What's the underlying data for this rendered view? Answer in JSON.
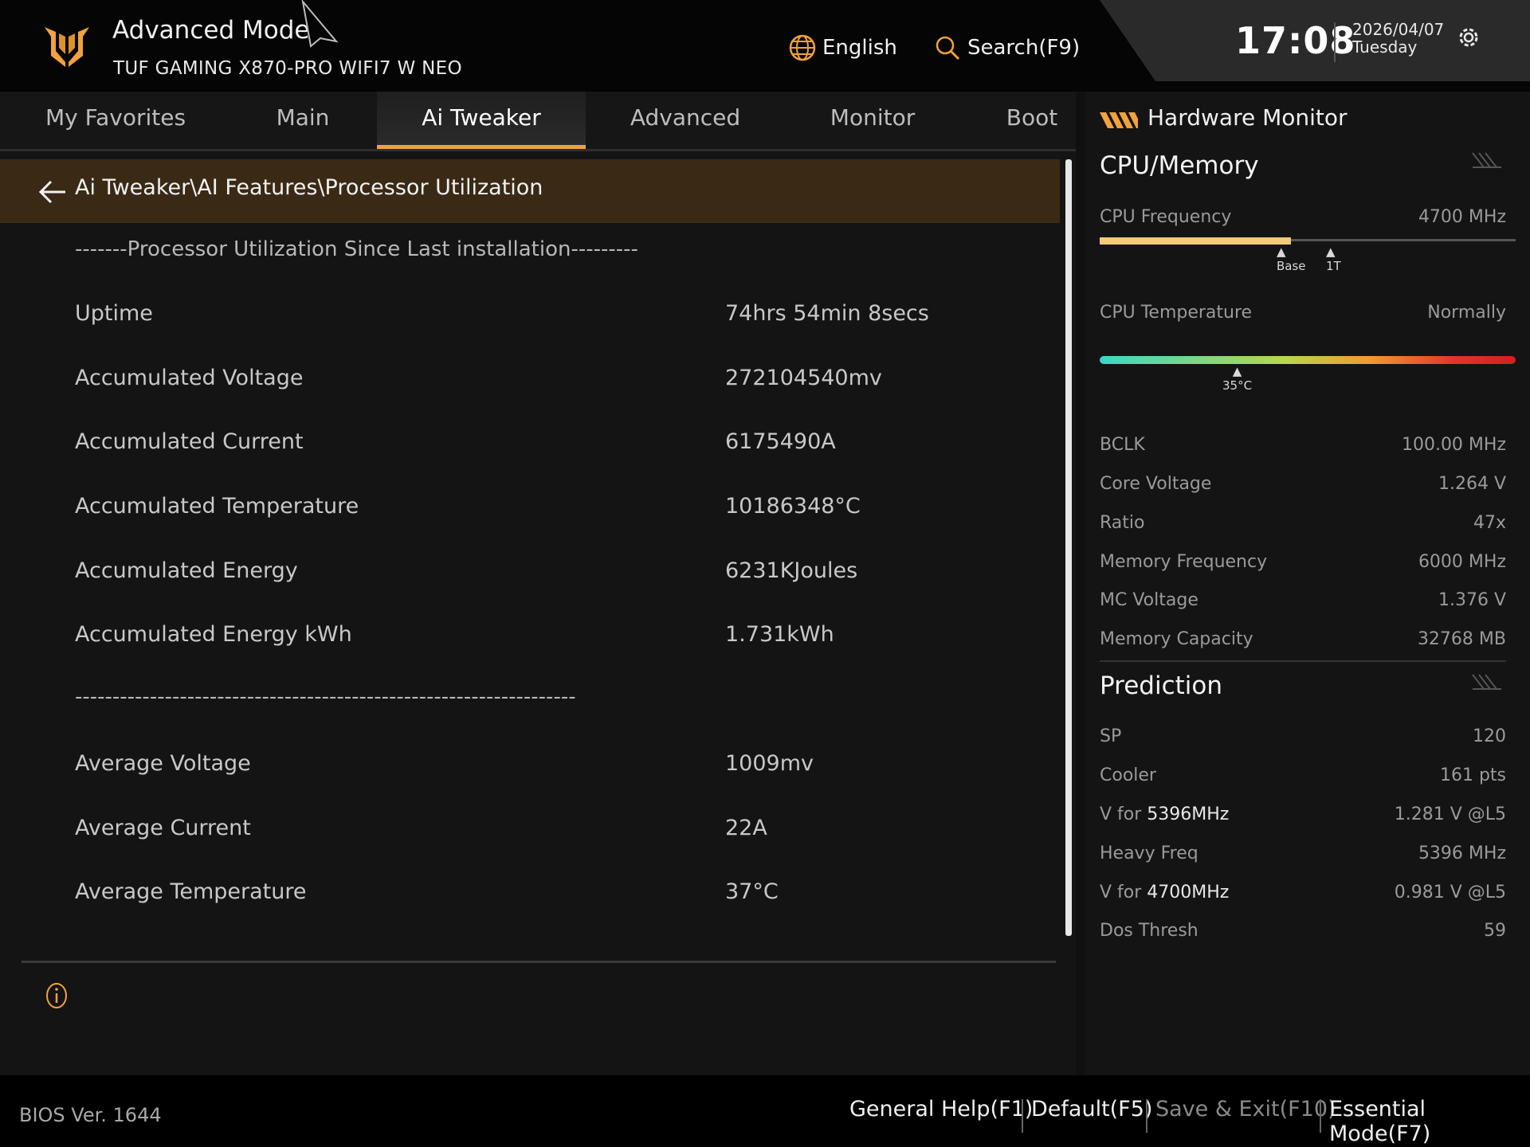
{
  "header": {
    "mode_title": "Advanced Mode",
    "board_name": "TUF GAMING X870-PRO WIFI7 W NEO",
    "language_label": "English",
    "search_label": "Search(F9)",
    "time": "17:08",
    "date": "2026/04/07",
    "weekday": "Tuesday"
  },
  "tabs": [
    {
      "label": "My Favorites"
    },
    {
      "label": "Main"
    },
    {
      "label": "Ai Tweaker"
    },
    {
      "label": "Advanced"
    },
    {
      "label": "Monitor"
    },
    {
      "label": "Boot"
    }
  ],
  "main": {
    "breadcrumb": "Ai Tweaker\\AI Features\\Processor Utilization",
    "section_header": "-------Processor Utilization Since Last installation---------",
    "separator": "-------------------------------------------------------------------",
    "rows": [
      {
        "label": "Uptime",
        "value": "74hrs 54min 8secs"
      },
      {
        "label": "Accumulated Voltage",
        "value": "272104540mv"
      },
      {
        "label": "Accumulated Current",
        "value": "6175490A"
      },
      {
        "label": "Accumulated Temperature",
        "value": "10186348°C"
      },
      {
        "label": "Accumulated Energy",
        "value": "6231KJoules"
      },
      {
        "label": "Accumulated Energy kWh",
        "value": "1.731kWh"
      }
    ],
    "avg_rows": [
      {
        "label": "Average Voltage",
        "value": "1009mv"
      },
      {
        "label": "Average Current",
        "value": "22A"
      },
      {
        "label": "Average Temperature",
        "value": "37°C"
      }
    ]
  },
  "hw_monitor": {
    "title": "Hardware Monitor",
    "cpu_section": "CPU/Memory",
    "cpu_freq_label": "CPU Frequency",
    "cpu_freq_value": "4700 MHz",
    "cpu_freq_fill_fraction": 0.46,
    "freq_marker_base": "Base",
    "freq_marker_1t": "1T",
    "cpu_temp_label": "CPU Temperature",
    "cpu_temp_value": "Normally",
    "cpu_temp_marker": "35°C",
    "stats": [
      {
        "label": "BCLK",
        "value": "100.00 MHz"
      },
      {
        "label": "Core Voltage",
        "value": "1.264 V"
      },
      {
        "label": "Ratio",
        "value": "47x"
      },
      {
        "label": "Memory Frequency",
        "value": "6000 MHz"
      },
      {
        "label": "MC Voltage",
        "value": "1.376 V"
      },
      {
        "label": "Memory Capacity",
        "value": "32768 MB"
      }
    ],
    "prediction_section": "Prediction",
    "prediction": [
      {
        "label": "SP",
        "value": "120"
      },
      {
        "label": "Cooler",
        "value": "161 pts"
      },
      {
        "label_prefix": "V for ",
        "label_bold": "5396MHz",
        "value": "1.281 V @L5"
      },
      {
        "label": "Heavy Freq",
        "value": "5396 MHz"
      },
      {
        "label_prefix": "V for ",
        "label_bold": "4700MHz",
        "value": "0.981 V @L5"
      },
      {
        "label": "Dos Thresh",
        "value": "59"
      }
    ]
  },
  "footer": {
    "bios_version": "BIOS Ver. 1644",
    "general_help": "General Help(F1)",
    "default": "Default(F5)",
    "save_exit": "Save & Exit(F10)",
    "essential_mode": "Essential Mode(F7)"
  },
  "colors": {
    "accent": "#f0a23c",
    "breadcrumb_bg": "#3a2a15",
    "background": "#141414"
  }
}
